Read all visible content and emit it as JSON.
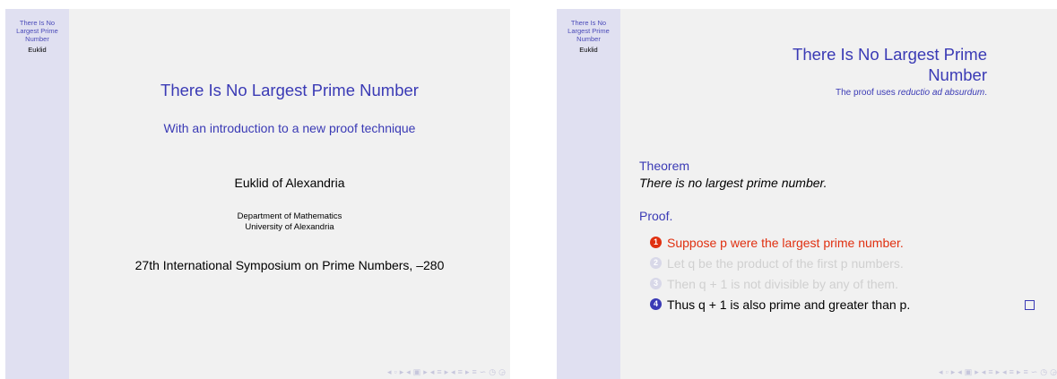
{
  "sidebar": {
    "title": "There Is No Largest Prime Number",
    "author": "Euklid"
  },
  "nav_symbols": [
    "◂",
    "▫",
    "▸",
    "◂",
    "▣",
    "▸",
    "◂",
    "≡",
    "▸",
    "◂",
    "≡",
    "▸",
    "≡",
    "∽",
    "◷",
    "◶"
  ],
  "slide1": {
    "title": "There Is No Largest Prime Number",
    "subtitle": "With an introduction to a new proof technique",
    "author": "Euklid of Alexandria",
    "institute_line1": "Department of Mathematics",
    "institute_line2": "University of Alexandria",
    "date": "27th International Symposium on Prime Numbers, –280"
  },
  "slide2": {
    "title_line1": "There Is No Largest Prime",
    "title_line2": "Number",
    "subtitle_prefix": "The proof uses ",
    "subtitle_italic": "reductio ad absurdum",
    "subtitle_suffix": ".",
    "theorem_label": "Theorem",
    "theorem_text": "There is no largest prime number.",
    "proof_label": "Proof.",
    "steps": [
      {
        "num": "1",
        "text": "Suppose p were the largest prime number."
      },
      {
        "num": "2",
        "text": "Let q be the product of the first p numbers."
      },
      {
        "num": "3",
        "text": "Then q + 1 is not divisible by any of them."
      },
      {
        "num": "4",
        "text": "Thus q + 1 is also prime and greater than p."
      }
    ]
  }
}
